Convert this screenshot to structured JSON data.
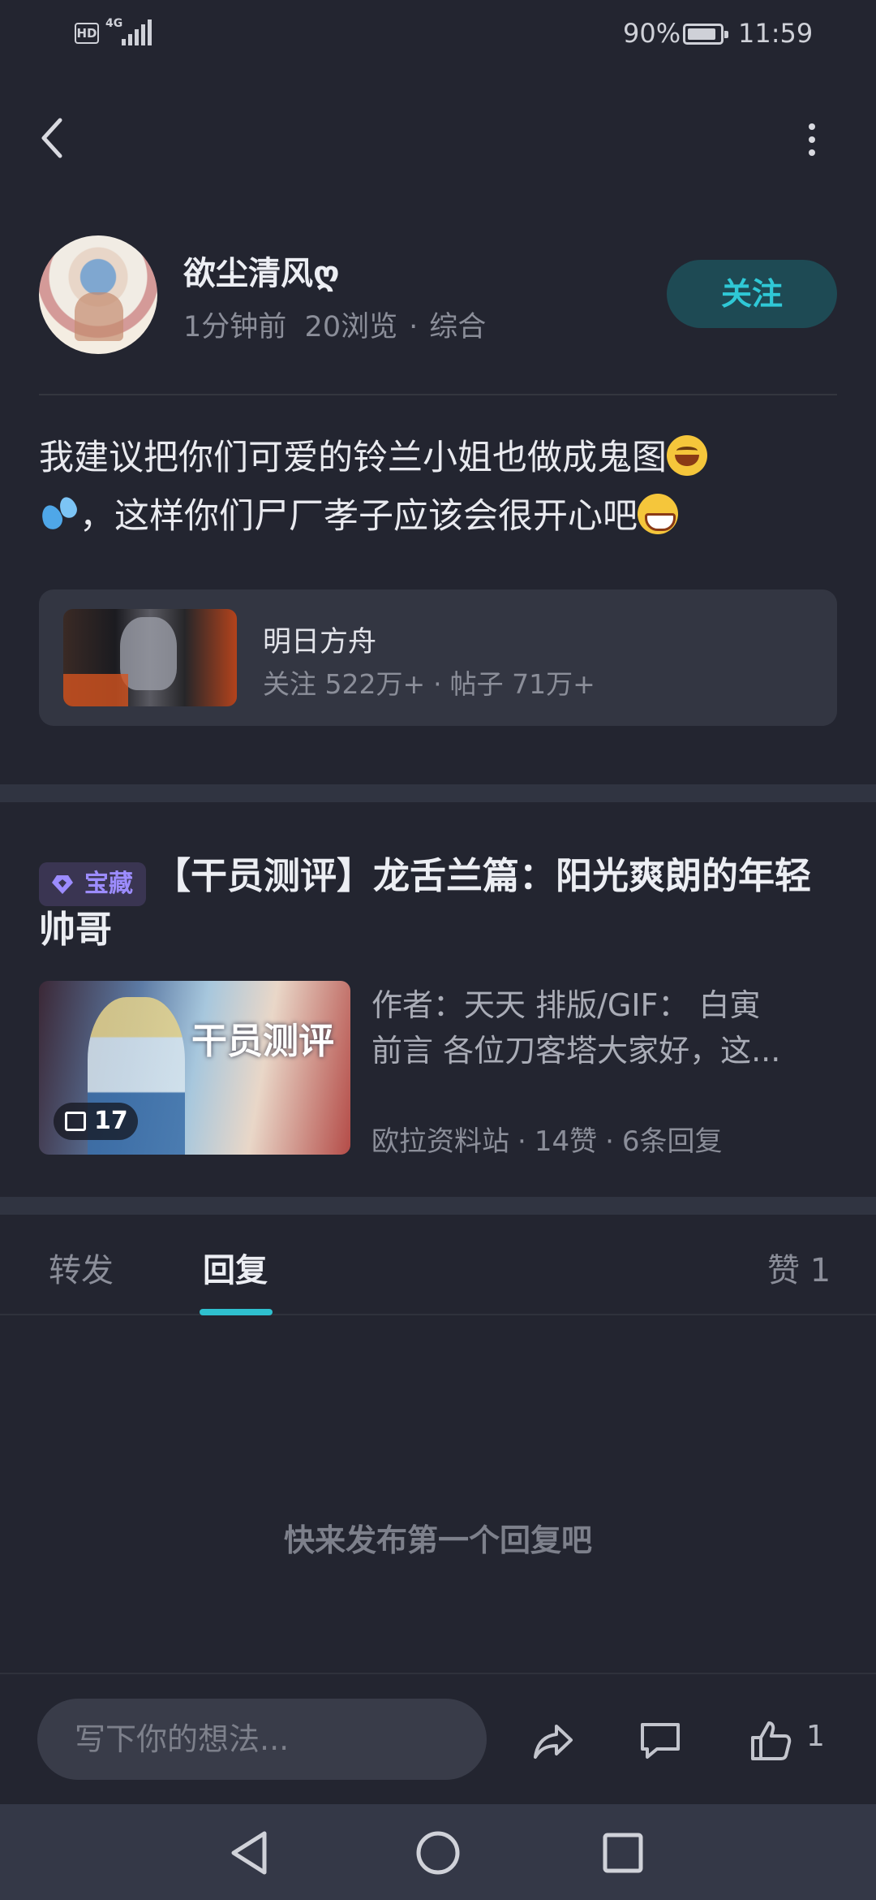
{
  "status_bar": {
    "hd": "HD",
    "network": "4G",
    "battery_pct": "90%",
    "battery_level": 0.9,
    "time": "11:59"
  },
  "author": {
    "name": "欲尘清风ღ",
    "time_ago": "1分钟前",
    "views": "20浏览",
    "category": "综合",
    "follow_label": "关注"
  },
  "post": {
    "line1": "我建议把你们可爱的铃兰小姐也做成鬼图",
    "line2": "，这样你们尸厂孝子应该会很开心吧"
  },
  "game_card": {
    "name": "明日方舟",
    "followers": "关注 522万+",
    "posts": "帖子 71万+"
  },
  "linked_article": {
    "badge": "宝藏",
    "title": "【干员测评】龙舌兰篇：阳光爽朗的年轻帅哥",
    "thumb_title": "干员测评",
    "image_count": "17",
    "excerpt_line1": "作者：天天  排版/GIF：  白寅",
    "excerpt_line2": "前言 各位刀客塔大家好，这...",
    "source": "欧拉资料站",
    "likes": "14赞",
    "replies": "6条回复"
  },
  "tabs": [
    {
      "label": "转发",
      "active": false
    },
    {
      "label": "回复",
      "active": true
    },
    {
      "label": "赞 1",
      "active": false
    }
  ],
  "empty_message": "快来发布第一个回复吧",
  "input": {
    "placeholder": "写下你的想法...",
    "like_count": "1"
  },
  "colors": {
    "background": "#232530",
    "accent": "#2fc0cf",
    "badge_purple": "#9c8cff"
  }
}
